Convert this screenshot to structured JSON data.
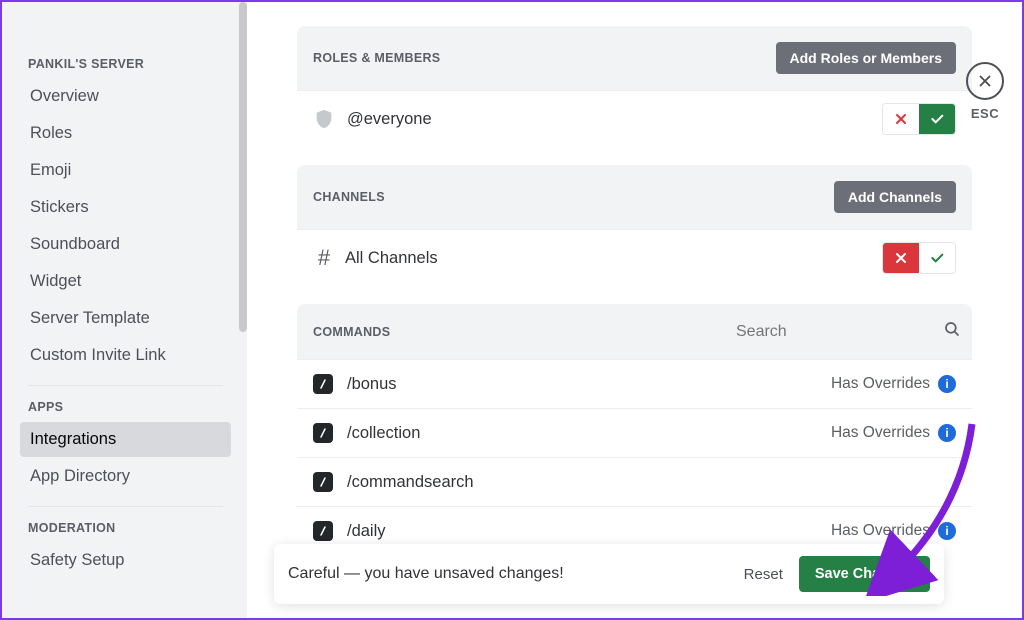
{
  "sidebar": {
    "server_heading": "PANKIL'S SERVER",
    "apps_heading": "APPS",
    "moderation_heading": "MODERATION",
    "items": {
      "overview": "Overview",
      "roles": "Roles",
      "emoji": "Emoji",
      "stickers": "Stickers",
      "soundboard": "Soundboard",
      "widget": "Widget",
      "server_template": "Server Template",
      "custom_invite": "Custom Invite Link",
      "integrations": "Integrations",
      "app_directory": "App Directory",
      "safety_setup": "Safety Setup"
    }
  },
  "esc": {
    "label": "ESC"
  },
  "roles_section": {
    "title": "ROLES & MEMBERS",
    "add_btn": "Add Roles or Members",
    "everyone": "@everyone"
  },
  "channels_section": {
    "title": "CHANNELS",
    "add_btn": "Add Channels",
    "all_channels": "All Channels"
  },
  "commands_section": {
    "title": "COMMANDS",
    "search_placeholder": "Search",
    "override_label": "Has Overrides",
    "items": [
      {
        "name": "/bonus",
        "has_override": true
      },
      {
        "name": "/collection",
        "has_override": true
      },
      {
        "name": "/commandsearch",
        "has_override": false
      },
      {
        "name": "/daily",
        "has_override": true
      }
    ]
  },
  "savebar": {
    "text": "Careful — you have unsaved changes!",
    "reset": "Reset",
    "save": "Save Changes"
  }
}
